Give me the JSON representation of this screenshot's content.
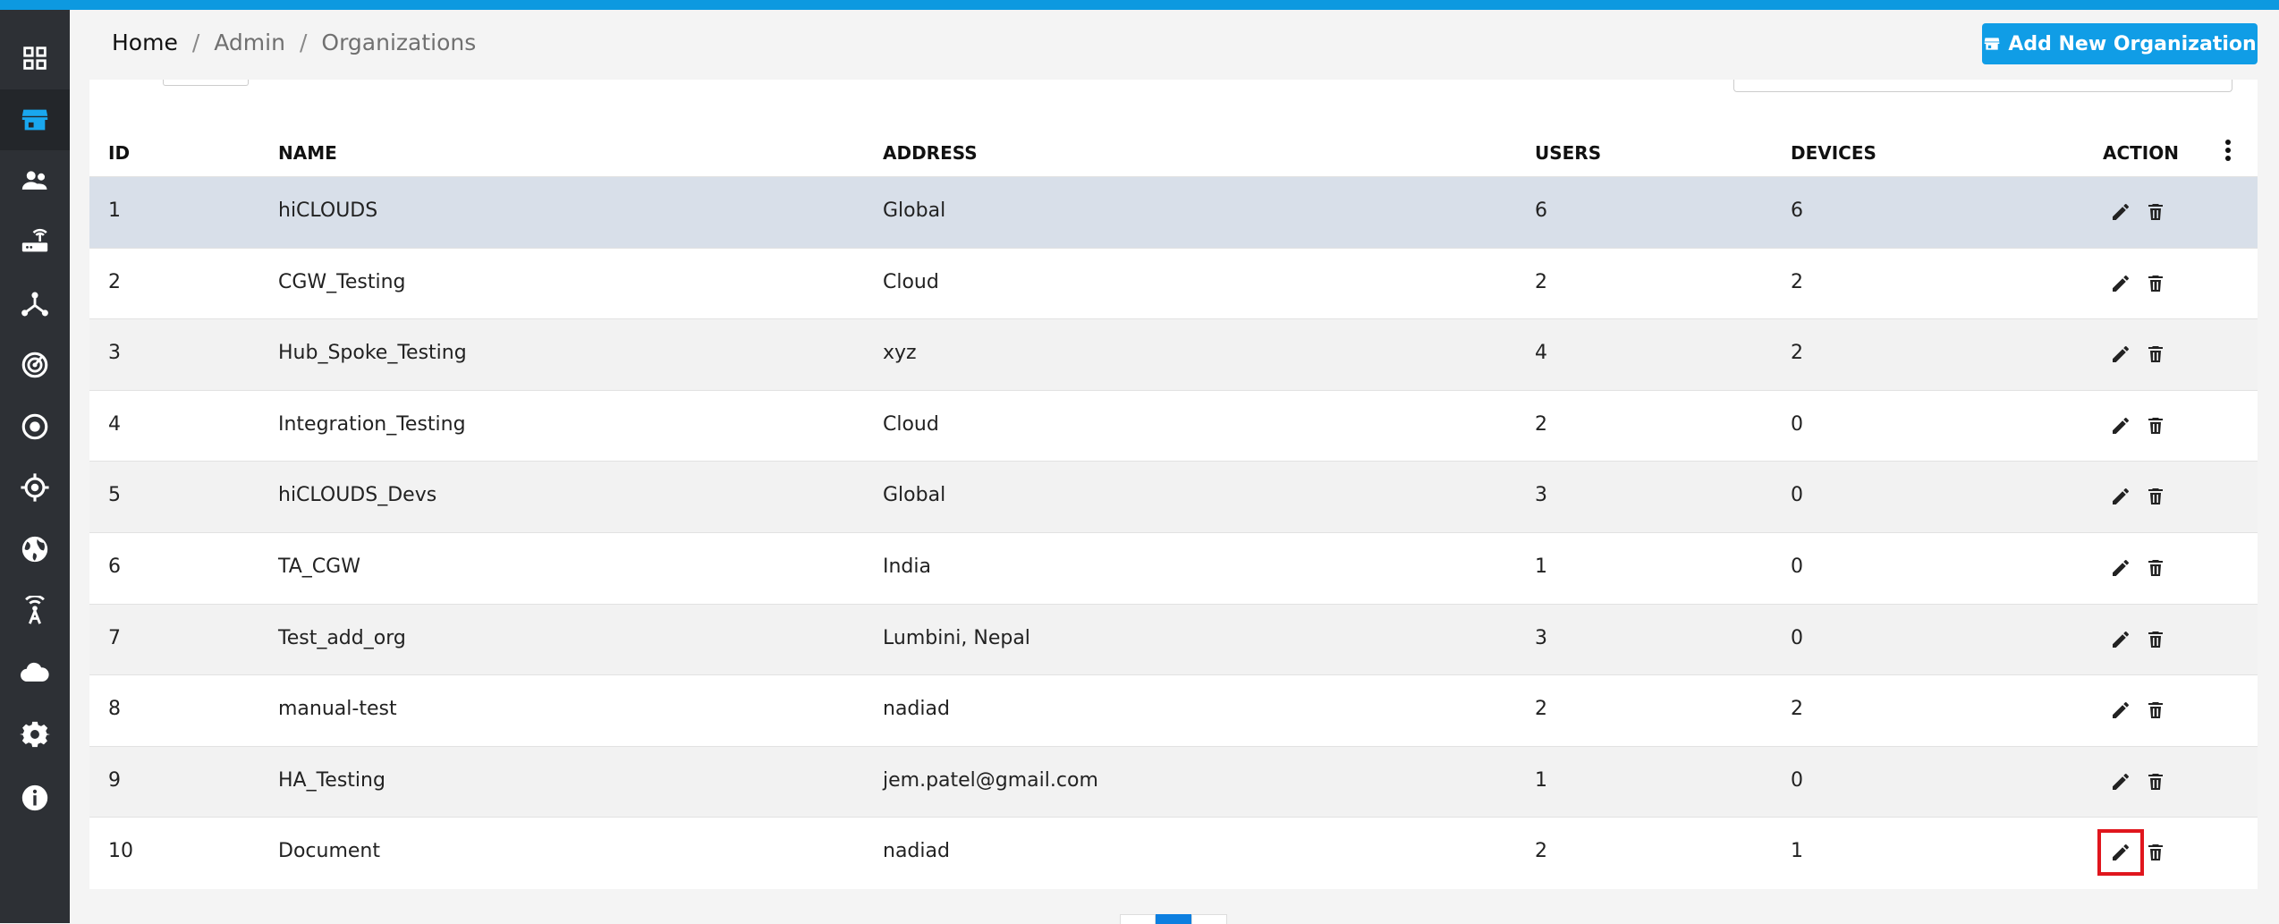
{
  "breadcrumb": {
    "home": "Home",
    "sep1": "/",
    "admin": "Admin",
    "sep2": "/",
    "current": "Organizations"
  },
  "actions": {
    "add_button_label": "Add New Organization"
  },
  "sidebar": {
    "items": [
      {
        "icon": "dashboard-icon"
      },
      {
        "icon": "organizations-store-icon",
        "active": true
      },
      {
        "icon": "users-icon"
      },
      {
        "icon": "router-device-icon"
      },
      {
        "icon": "network-topology-icon"
      },
      {
        "icon": "monitoring-radar-icon"
      },
      {
        "icon": "target-circle-icon"
      },
      {
        "icon": "gps-locate-icon"
      },
      {
        "icon": "globe-icon"
      },
      {
        "icon": "antenna-wireless-icon"
      },
      {
        "icon": "cloud-icon"
      },
      {
        "icon": "settings-gear-icon"
      },
      {
        "icon": "info-icon"
      }
    ]
  },
  "table": {
    "columns": [
      "ID",
      "NAME",
      "ADDRESS",
      "USERS",
      "DEVICES",
      "ACTION"
    ],
    "rows": [
      {
        "id": "1",
        "name": "hiCLOUDS",
        "address": "Global",
        "users": "6",
        "devices": "6"
      },
      {
        "id": "2",
        "name": "CGW_Testing",
        "address": "Cloud",
        "users": "2",
        "devices": "2"
      },
      {
        "id": "3",
        "name": "Hub_Spoke_Testing",
        "address": "xyz",
        "users": "4",
        "devices": "2"
      },
      {
        "id": "4",
        "name": "Integration_Testing",
        "address": "Cloud",
        "users": "2",
        "devices": "0"
      },
      {
        "id": "5",
        "name": "hiCLOUDS_Devs",
        "address": "Global",
        "users": "3",
        "devices": "0"
      },
      {
        "id": "6",
        "name": "TA_CGW",
        "address": "India",
        "users": "1",
        "devices": "0"
      },
      {
        "id": "7",
        "name": "Test_add_org",
        "address": "Lumbini, Nepal",
        "users": "3",
        "devices": "0"
      },
      {
        "id": "8",
        "name": "manual-test",
        "address": "nadiad",
        "users": "2",
        "devices": "2"
      },
      {
        "id": "9",
        "name": "HA_Testing",
        "address": "jem.patel@gmail.com",
        "users": "1",
        "devices": "0"
      },
      {
        "id": "10",
        "name": "Document",
        "address": "nadiad",
        "users": "2",
        "devices": "1"
      }
    ]
  },
  "colors": {
    "accent": "#0d99e0",
    "sidebar_bg": "#2d3035",
    "selected_row": "#d8dfe9",
    "highlight_outline": "#e0161d"
  }
}
